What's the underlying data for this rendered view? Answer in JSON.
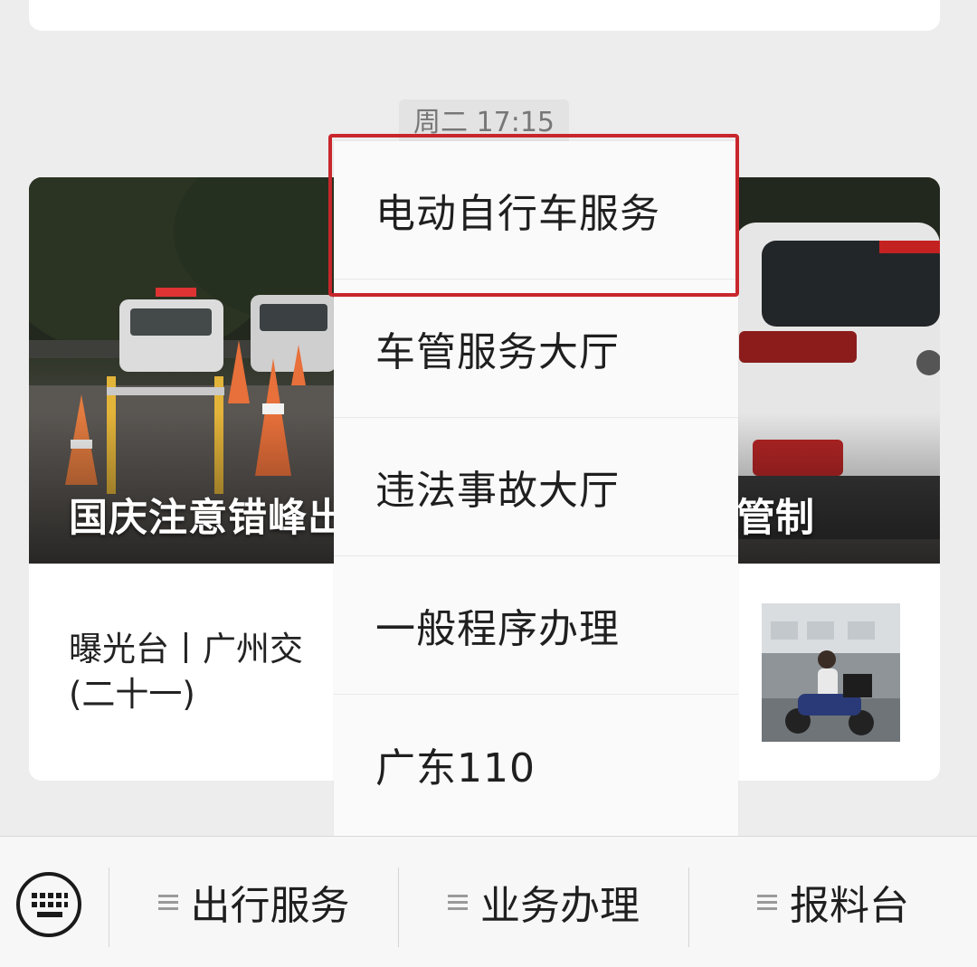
{
  "timestamp": "周二 17:15",
  "article": {
    "hero_caption": "国庆注意错峰出",
    "hero_caption_right": "管制",
    "title": "曝光台丨广州交\n(二十一)"
  },
  "popup_menu": {
    "items": [
      {
        "label": "电动自行车服务",
        "highlighted": true
      },
      {
        "label": "车管服务大厅"
      },
      {
        "label": "违法事故大厅"
      },
      {
        "label": "一般程序办理"
      },
      {
        "label": "广东110"
      }
    ],
    "highlight_color": "#c8262c"
  },
  "bottom_bar": {
    "keyboard_icon": "keyboard-icon",
    "menus": [
      {
        "label": "出行服务",
        "icon": "menu-lines-icon"
      },
      {
        "label": "业务办理",
        "icon": "menu-lines-icon"
      },
      {
        "label": "报料台",
        "icon": "menu-lines-icon"
      }
    ]
  }
}
